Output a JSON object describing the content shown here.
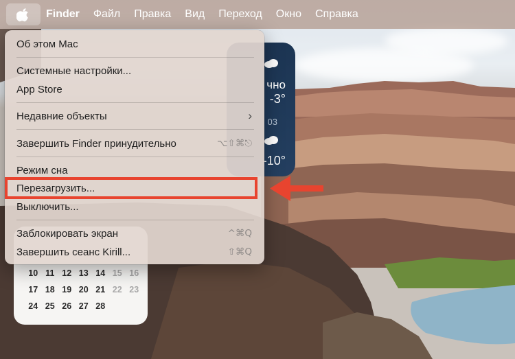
{
  "menubar": {
    "apple_icon": "apple-logo-icon",
    "app_name": "Finder",
    "items": [
      "Файл",
      "Правка",
      "Вид",
      "Переход",
      "Окно",
      "Справка"
    ]
  },
  "apple_menu": {
    "about": "Об этом Mac",
    "system_settings": "Системные настройки...",
    "app_store": "App Store",
    "recent_items": "Недавние объекты",
    "force_quit": "Завершить Finder принудительно",
    "force_quit_shortcut": "⌥⇧⌘⎋",
    "sleep": "Режим сна",
    "restart": "Перезагрузить...",
    "shutdown": "Выключить...",
    "lock_screen": "Заблокировать экран",
    "lock_screen_shortcut": "^⌘Q",
    "logout": "Завершить сеанс Kirill...",
    "logout_shortcut": "⇧⌘Q"
  },
  "weather_widget": {
    "condition_partial": "чно",
    "temp_1": "-3°",
    "time_partial": "03",
    "temp_2": "-10°"
  },
  "calendar_widget": {
    "rows": [
      [
        "10",
        "11",
        "12",
        "13",
        "14",
        "15",
        "16"
      ],
      [
        "17",
        "18",
        "19",
        "20",
        "21",
        "22",
        "23"
      ],
      [
        "24",
        "25",
        "26",
        "27",
        "28"
      ]
    ]
  },
  "annotation": {
    "highlight_color": "#e8442f"
  }
}
